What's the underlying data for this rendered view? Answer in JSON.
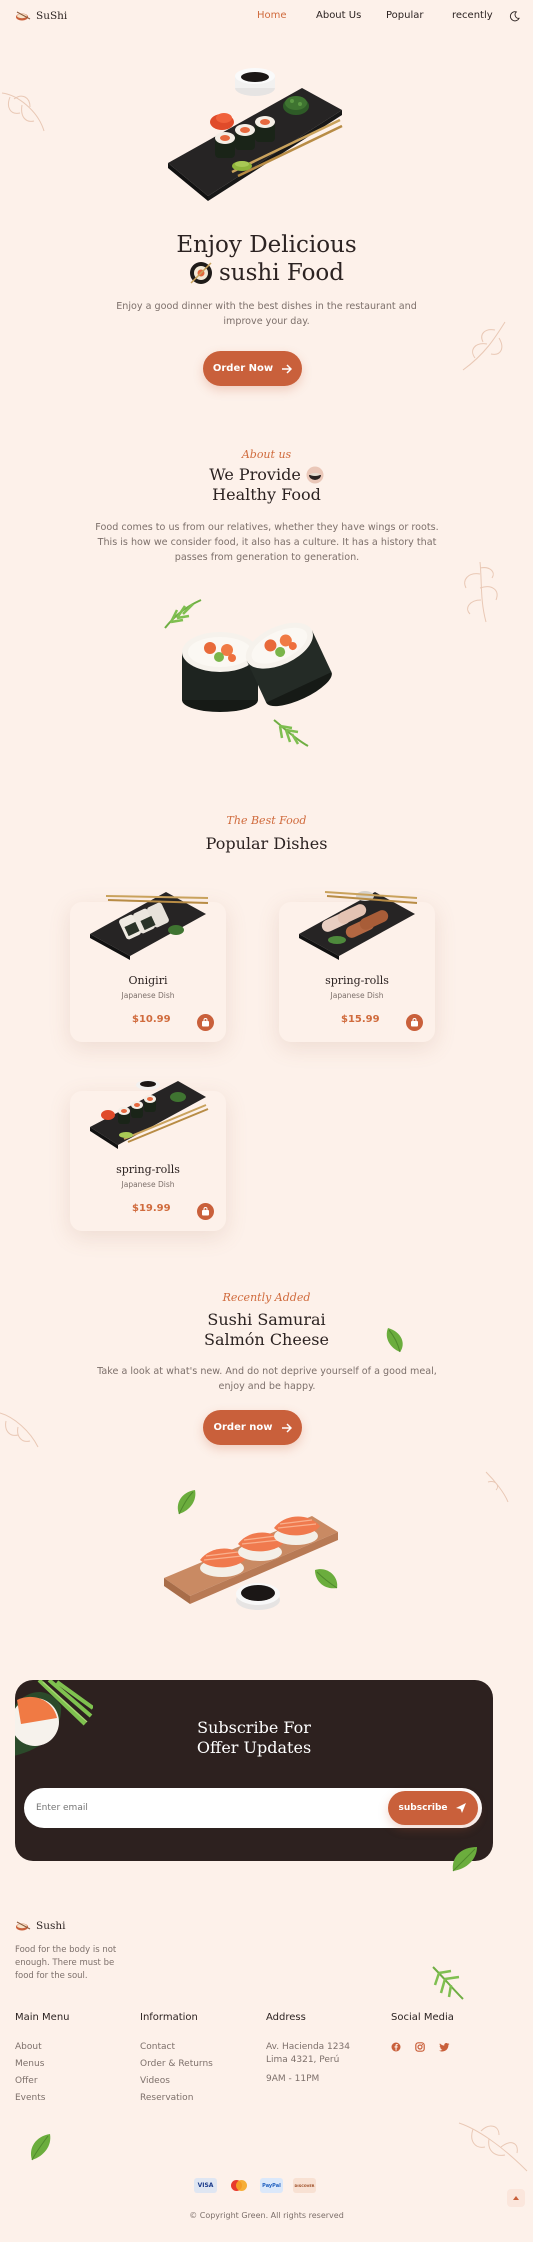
{
  "brand": {
    "name": "SuShi"
  },
  "nav": {
    "items": [
      "Home",
      "About Us",
      "Popular",
      "recently"
    ],
    "active_index": 0,
    "theme_icon": "moon-icon"
  },
  "hero": {
    "title_line1": "Enjoy Delicious",
    "title_line2": "sushi Food",
    "description": "Enjoy a good dinner with the best dishes in the restaurant and improve your day.",
    "button_label": "Order Now"
  },
  "about": {
    "kicker": "About us",
    "title_line1": "We Provide",
    "title_line2": "Healthy Food",
    "description": "Food comes to us from our relatives, whether they have wings or roots. This is how we consider food, it also has a culture. It has a history that passes from generation to generation."
  },
  "popular": {
    "kicker": "The Best Food",
    "title": "Popular Dishes",
    "items": [
      {
        "name": "Onigiri",
        "subtitle": "Japanese Dish",
        "price": "$10.99"
      },
      {
        "name": "spring-rolls",
        "subtitle": "Japanese Dish",
        "price": "$15.99"
      },
      {
        "name": "spring-rolls",
        "subtitle": "Japanese Dish",
        "price": "$19.99"
      }
    ]
  },
  "recent": {
    "kicker": "Recently Added",
    "title_line1": "Sushi Samurai",
    "title_line2": "Salmón Cheese",
    "description": "Take a look at what's new. And do not deprive yourself of a good meal, enjoy and be happy.",
    "button_label": "Order now"
  },
  "subscribe": {
    "title_line1": "Subscribe For",
    "title_line2": "Offer Updates",
    "placeholder": "Enter email",
    "button_label": "subscribe"
  },
  "footer": {
    "brand": "Sushi",
    "tagline": "Food for the body is not enough. There must be food for the soul.",
    "columns": [
      {
        "title": "Main Menu",
        "links": [
          "About",
          "Menus",
          "Offer",
          "Events"
        ]
      },
      {
        "title": "Information",
        "links": [
          "Contact",
          "Order & Returns",
          "Videos",
          "Reservation"
        ]
      },
      {
        "title": "Address",
        "links": [
          "Av. Hacienda 1234",
          "Lima 4321, Perú",
          "9AM - 11PM"
        ]
      },
      {
        "title": "Social Media",
        "icons": [
          "facebook-icon",
          "instagram-icon",
          "twitter-icon"
        ]
      }
    ],
    "payments": [
      "VISA",
      "",
      "PayPal",
      "DISCOVER"
    ],
    "copyright": "© Copyright Green. All rights reserved"
  },
  "colors": {
    "accent": "#c9603b",
    "background": "#fdf1ea",
    "dark": "#2d211f"
  }
}
